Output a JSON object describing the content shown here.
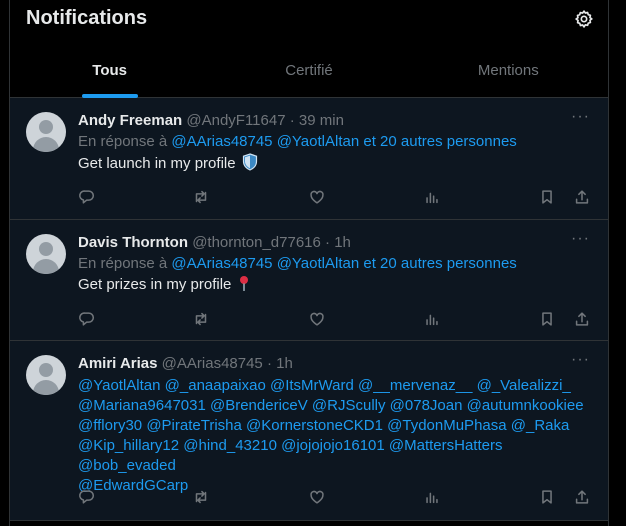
{
  "header": {
    "title": "Notifications",
    "settings_icon": "gear-icon"
  },
  "tabs": [
    {
      "label": "Tous",
      "active": true
    },
    {
      "label": "Certifié",
      "active": false
    },
    {
      "label": "Mentions",
      "active": false
    }
  ],
  "colors": {
    "accent": "#1d9bf0",
    "muted": "#71767b",
    "background": "#000000",
    "post_background": "#0d1620"
  },
  "posts": [
    {
      "name": "Andy Freeman",
      "handle": "@AndyF11647",
      "dot": "·",
      "time": "39 min",
      "reply_prefix": "En réponse à",
      "reply_mentions": "@AArias48745 @YaotlAltan",
      "reply_suffix": "et 20 autres personnes",
      "text": "Get launch in my profile",
      "emoji": "shield-icon"
    },
    {
      "name": "Davis Thornton",
      "handle": "@thornton_d77616",
      "dot": "·",
      "time": "1h",
      "reply_prefix": "En réponse à",
      "reply_mentions": "@AArias48745 @YaotlAltan",
      "reply_suffix": "et 20 autres personnes",
      "text": "Get prizes in my profile",
      "emoji": "pin-icon"
    },
    {
      "name": "Amiri Arias",
      "handle": "@AArias48745",
      "dot": "·",
      "time": "1h",
      "mention_lines": [
        "@YaotlAltan @_anaapaixao @ItsMrWard @__mervenaz__ @_Valealizzi_",
        "@Mariana9647031 @BrendericeV @RJScully @078Joan @autumnkookiee",
        "@fflory30 @PirateTrisha @KornerstoneCKD1 @TydonMuPhasa @_Raka",
        "@Kip_hillary12 @hind_43210 @jojojojo16101 @MattersHatters @bob_evaded",
        "@EdwardGCarp"
      ]
    }
  ],
  "action_icons": [
    "reply-icon",
    "retweet-icon",
    "like-icon",
    "views-icon",
    "bookmark-icon",
    "share-icon"
  ],
  "more_label": "···"
}
